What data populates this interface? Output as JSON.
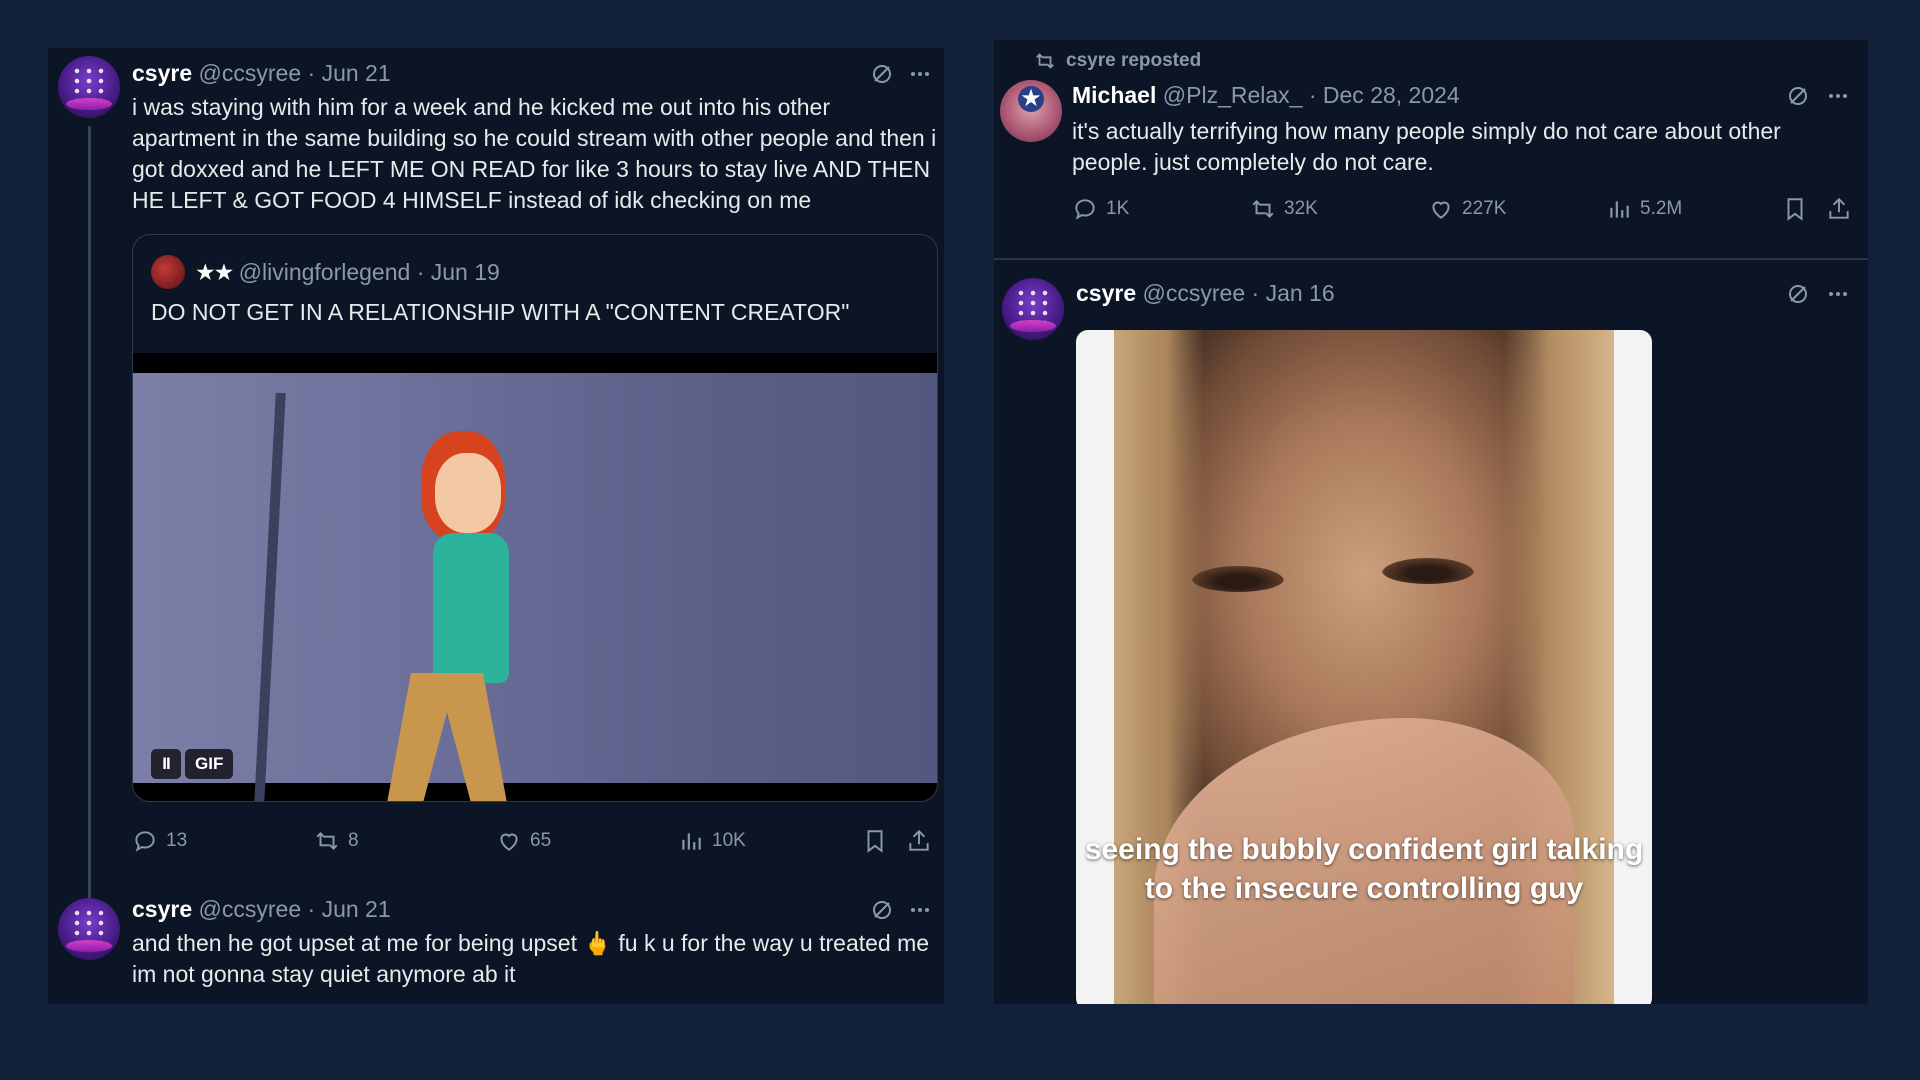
{
  "left": {
    "tweet1": {
      "name": "csyre",
      "handle": "@ccsyree",
      "date": "Jun 21",
      "text": "i was staying with him for a week and he kicked me out into his other apartment in the same building so he could stream with other people and then i got doxxed and he LEFT ME ON READ for like 3 hours to stay live AND THEN HE LEFT & GOT FOOD 4 HIMSELF instead of idk checking on me",
      "quote": {
        "stars": "★★",
        "handle": "@livingforlegend",
        "date": "Jun 19",
        "text": "DO NOT GET IN A RELATIONSHIP WITH A \"CONTENT CREATOR\"",
        "pause": "II",
        "gif_badge": "GIF"
      },
      "stats": {
        "replies": "13",
        "reposts": "8",
        "likes": "65",
        "views": "10K"
      }
    },
    "tweet2": {
      "name": "csyre",
      "handle": "@ccsyree",
      "date": "Jun 21",
      "text": "and then he got upset at me for being upset 🖕 fu k u for the way u treated me im not gonna stay quiet anymore ab it"
    }
  },
  "right": {
    "repost_label": "csyre reposted",
    "tweet1": {
      "name": "Michael",
      "handle": "@Plz_Relax_",
      "date": "Dec 28, 2024",
      "text": "it's actually terrifying how many people simply do not care about other people. just completely do not care.",
      "stats": {
        "replies": "1K",
        "reposts": "32K",
        "likes": "227K",
        "views": "5.2M"
      }
    },
    "tweet2": {
      "name": "csyre",
      "handle": "@ccsyree",
      "date": "Jan 16",
      "video_caption": "seeing the bubbly confident girl talking to the insecure controlling guy"
    }
  },
  "icons": [
    "grok-icon",
    "more-icon",
    "reply-icon",
    "repost-icon",
    "like-icon",
    "views-icon",
    "bookmark-icon",
    "share-icon"
  ]
}
